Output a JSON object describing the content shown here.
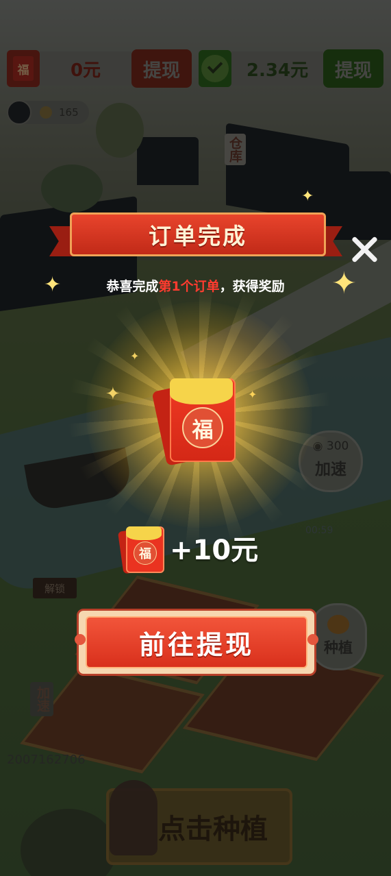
{
  "hud": {
    "red_icon_char": "福",
    "red_amount": "0元",
    "red_withdraw_label": "提现",
    "green_amount": "2.34元",
    "green_withdraw_label": "提现"
  },
  "profile": {
    "coins": "165"
  },
  "scene": {
    "warehouse_label": "仓库",
    "speed_cost": "300",
    "speed_label": "加速",
    "timer": "00:59",
    "plant_bubble_label": "种植",
    "unlock_label": "解锁",
    "speed_side_label": "加速",
    "user_id": "2007162706",
    "plant_button_label": "点击种植"
  },
  "modal": {
    "title": "订单完成",
    "subtitle_prefix": "恭喜完成",
    "subtitle_highlight": "第1个订单",
    "subtitle_suffix": "，获得奖励",
    "envelope_char": "福",
    "reward_amount": "+10元",
    "go_withdraw_label": "前往提现"
  },
  "colors": {
    "accent_red": "#e8442c",
    "highlight_red": "#ff3b2f",
    "gold": "#f6d44a"
  }
}
